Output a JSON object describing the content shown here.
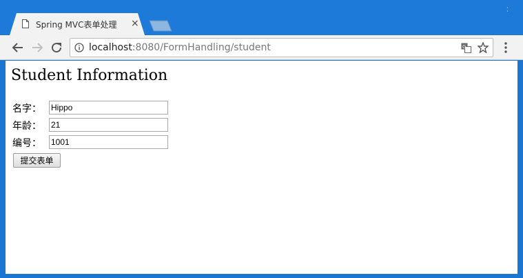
{
  "browser": {
    "tab": {
      "title": "Spring MVC表单处理",
      "close_glyph": "×",
      "icon": "document-icon"
    },
    "new_tab_icon": "new-tab-icon",
    "nav": {
      "back_icon": "back-arrow-icon",
      "forward_icon": "forward-arrow-icon",
      "reload_icon": "reload-icon"
    },
    "address_bar": {
      "host": "localhost",
      "path": ":8080/FormHandling/student",
      "info_icon": "info-icon",
      "translate_icon": "translate-icon",
      "bookmark_icon": "star-icon"
    },
    "menu_icon": "three-dot-menu-icon",
    "accent_color": "#1e7ad9"
  },
  "page": {
    "heading": "Student Information",
    "form": {
      "fields": [
        {
          "label": "名字：",
          "value": "Hippo"
        },
        {
          "label": "年龄：",
          "value": "21"
        },
        {
          "label": "编号：",
          "value": "1001"
        }
      ],
      "submit_label": "提交表单"
    }
  }
}
